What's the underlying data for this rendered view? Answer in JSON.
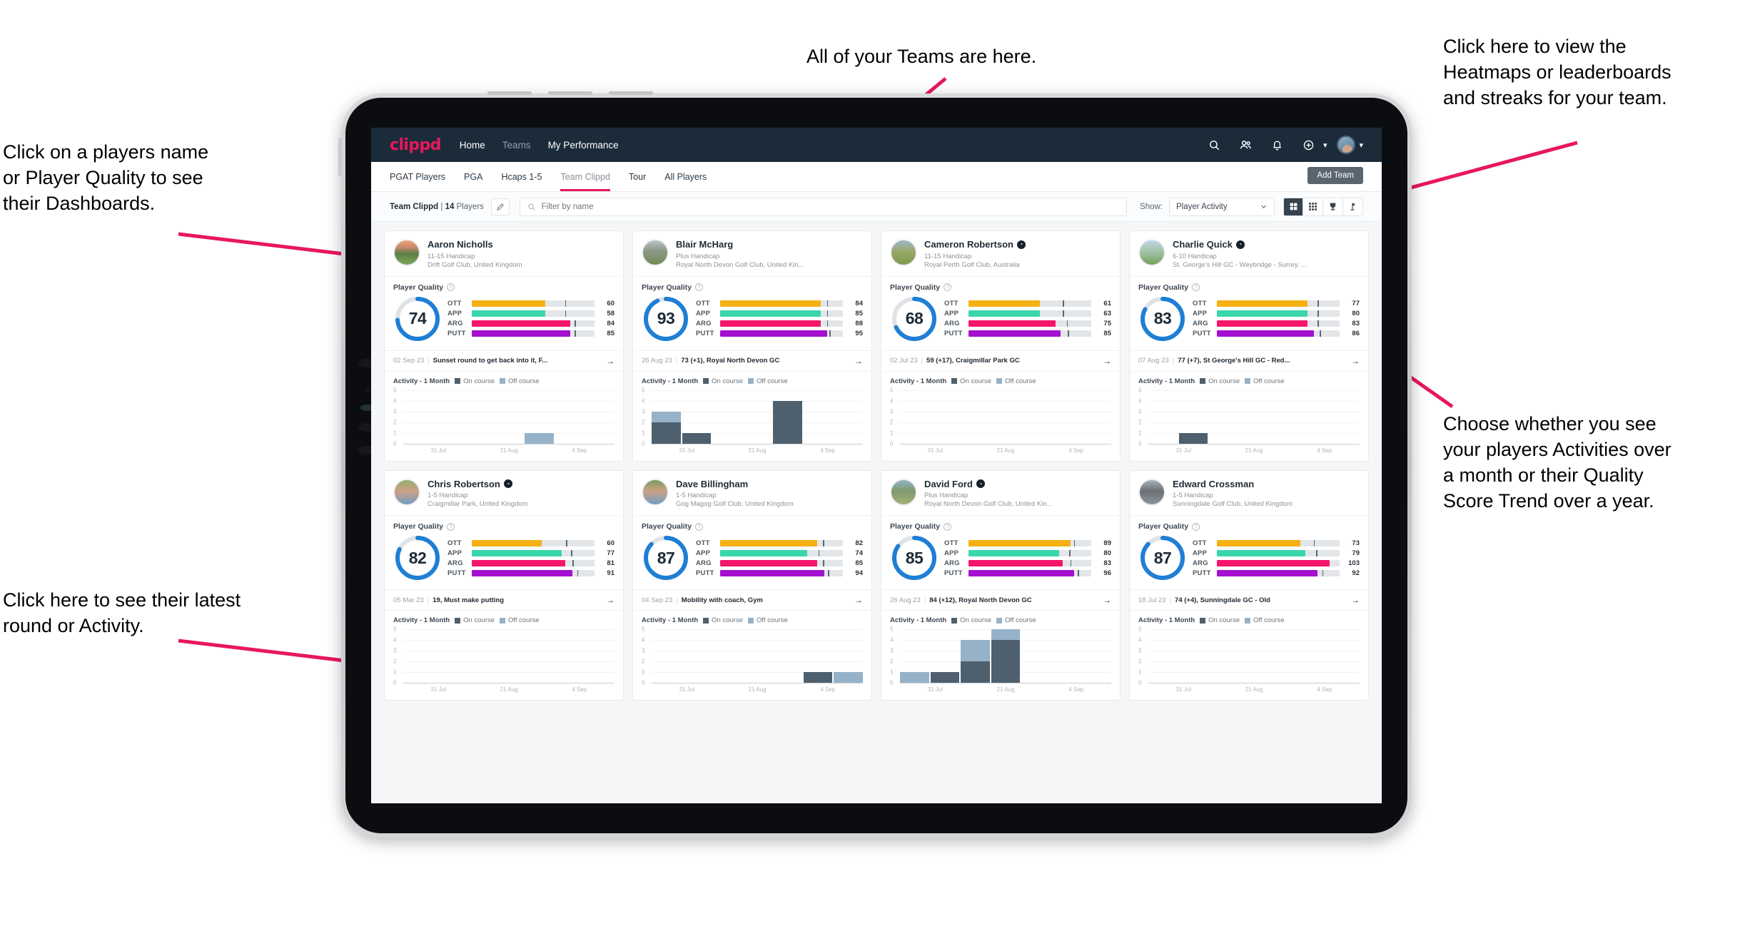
{
  "annotations": [
    {
      "id": "teams",
      "text": "All of your Teams are here."
    },
    {
      "id": "heatmaps",
      "text": "Click here to view the\nHeatmaps or leaderboards\nand streaks for your team."
    },
    {
      "id": "players-name",
      "text": "Click on a players name\nor Player Quality to see\ntheir Dashboards."
    },
    {
      "id": "activity-toggle",
      "text": "Choose whether you see\nyour players Activities over\na month or their Quality\nScore Trend over a year."
    },
    {
      "id": "latest-round",
      "text": "Click here to see their latest\nround or Activity."
    }
  ],
  "app": {
    "logo": "clippd",
    "nav_links": [
      {
        "label": "Home",
        "state": "active"
      },
      {
        "label": "Teams",
        "state": "dim"
      },
      {
        "label": "My Performance",
        "state": "active"
      }
    ],
    "nav_icons": [
      {
        "name": "search-icon"
      },
      {
        "name": "people-icon"
      },
      {
        "name": "bell-icon"
      },
      {
        "name": "plus-circle-icon"
      }
    ],
    "tabs": [
      {
        "label": "PGAT Players",
        "active": false
      },
      {
        "label": "PGA",
        "active": false
      },
      {
        "label": "Hcaps 1-5",
        "active": false
      },
      {
        "label": "Team Clippd",
        "active": true
      },
      {
        "label": "Tour",
        "active": false
      },
      {
        "label": "All Players",
        "active": false
      }
    ],
    "add_team_label": "Add Team",
    "filter": {
      "team_name": "Team Clippd",
      "team_separator": "|",
      "player_count": "14",
      "players_word": "Players",
      "search_placeholder": "Filter by name",
      "search_value": "",
      "show_label": "Show:",
      "show_value": "Player Activity",
      "view_icons": [
        "grid-large-icon",
        "grid-small-icon",
        "trophy-icon",
        "flag-icon"
      ]
    }
  },
  "card_labels": {
    "player_quality": "Player Quality",
    "activity_title": "Activity - 1 Month",
    "legend_on": "On course",
    "legend_off": "Off course",
    "x_ticks": [
      "31 Jul",
      "21 Aug",
      "4 Sep"
    ],
    "y_ticks": [
      "5",
      "4",
      "3",
      "2",
      "1",
      "0"
    ]
  },
  "metric_colors": {
    "OTT": "#f5b014",
    "APP": "#3ad6ab",
    "ARG": "#f5156c",
    "PUTT": "#a50fd0",
    "dial": "#1e7fd4",
    "track": "#dfe3e7"
  },
  "chart_data": {
    "type": "bar",
    "title": "Activity - 1 Month",
    "ylabel": "",
    "xlabel": "",
    "ylim": [
      0,
      5
    ],
    "grid": true,
    "legend_position": "top",
    "categories": [
      "31 Jul",
      "21 Aug",
      "4 Sep"
    ],
    "series_names": [
      "On course",
      "Off course"
    ],
    "per_player": [
      {
        "player": "Aaron Nicholls",
        "on_course": [
          0,
          0,
          0,
          0,
          0,
          0,
          0
        ],
        "off_course": [
          0,
          0,
          0,
          0,
          1,
          0,
          0
        ]
      },
      {
        "player": "Blair McHarg",
        "on_course": [
          2,
          1,
          0,
          0,
          4,
          0,
          0
        ],
        "off_course": [
          1,
          0,
          0,
          0,
          0,
          0,
          0
        ]
      },
      {
        "player": "Cameron Robertson",
        "on_course": [
          0,
          0,
          0,
          0,
          0,
          0,
          0
        ],
        "off_course": [
          0,
          0,
          0,
          0,
          0,
          0,
          0
        ]
      },
      {
        "player": "Charlie Quick",
        "on_course": [
          0,
          1,
          0,
          0,
          0,
          0,
          0
        ],
        "off_course": [
          0,
          0,
          0,
          0,
          0,
          0,
          0
        ]
      },
      {
        "player": "Chris Robertson",
        "on_course": [
          0,
          0,
          0,
          0,
          0,
          0,
          0
        ],
        "off_course": [
          0,
          0,
          0,
          0,
          0,
          0,
          0
        ]
      },
      {
        "player": "Dave Billingham",
        "on_course": [
          0,
          0,
          0,
          0,
          0,
          1,
          0
        ],
        "off_course": [
          0,
          0,
          0,
          0,
          0,
          0,
          1
        ]
      },
      {
        "player": "David Ford",
        "on_course": [
          0,
          1,
          2,
          4,
          0,
          0,
          0
        ],
        "off_course": [
          1,
          0,
          2,
          1,
          0,
          0,
          0
        ]
      },
      {
        "player": "Edward Crossman",
        "on_course": [
          0,
          0,
          0,
          0,
          0,
          0,
          0
        ],
        "off_course": [
          0,
          0,
          0,
          0,
          0,
          0,
          0
        ]
      }
    ]
  },
  "players": [
    {
      "name": "Aaron Nicholls",
      "verified": false,
      "handicap": "11-15 Handicap",
      "club": "Drift Golf Club, United Kingdom",
      "quality": 74,
      "metrics": [
        {
          "label": "OTT",
          "value": 60,
          "fill": 60,
          "tick": 76
        },
        {
          "label": "APP",
          "value": 58,
          "fill": 60,
          "tick": 76
        },
        {
          "label": "ARG",
          "value": 84,
          "fill": 80,
          "tick": 84
        },
        {
          "label": "PUTT",
          "value": 85,
          "fill": 80,
          "tick": 84
        }
      ],
      "latest_date": "02 Sep 23",
      "latest_text": "Sunset round to get back into it, F...",
      "avatar": "course-sunset"
    },
    {
      "name": "Blair McHarg",
      "verified": false,
      "handicap": "Plus Handicap",
      "club": "Royal North Devon Golf Club, United Kin...",
      "quality": 93,
      "metrics": [
        {
          "label": "OTT",
          "value": 84,
          "fill": 82,
          "tick": 87
        },
        {
          "label": "APP",
          "value": 85,
          "fill": 82,
          "tick": 87
        },
        {
          "label": "ARG",
          "value": 88,
          "fill": 82,
          "tick": 87
        },
        {
          "label": "PUTT",
          "value": 95,
          "fill": 87,
          "tick": 89
        }
      ],
      "latest_date": "26 Aug 23",
      "latest_text": "73 (+1), Royal North Devon GC",
      "avatar": "golfer-green"
    },
    {
      "name": "Cameron Robertson",
      "verified": true,
      "handicap": "11-15 Handicap",
      "club": "Royal Perth Golf Club, Australia",
      "quality": 68,
      "metrics": [
        {
          "label": "OTT",
          "value": 61,
          "fill": 58,
          "tick": 77
        },
        {
          "label": "APP",
          "value": 63,
          "fill": 58,
          "tick": 77
        },
        {
          "label": "ARG",
          "value": 75,
          "fill": 71,
          "tick": 80
        },
        {
          "label": "PUTT",
          "value": 85,
          "fill": 75,
          "tick": 81
        }
      ],
      "latest_date": "02 Jul 23",
      "latest_text": "59 (+17), Craigmillar Park GC",
      "avatar": "fairway"
    },
    {
      "name": "Charlie Quick",
      "verified": true,
      "handicap": "6-10 Handicap",
      "club": "St. George's Hill GC - Weybridge - Surrey, ...",
      "quality": 83,
      "metrics": [
        {
          "label": "OTT",
          "value": 77,
          "fill": 74,
          "tick": 82
        },
        {
          "label": "APP",
          "value": 80,
          "fill": 74,
          "tick": 82
        },
        {
          "label": "ARG",
          "value": 83,
          "fill": 74,
          "tick": 82
        },
        {
          "label": "PUTT",
          "value": 86,
          "fill": 79,
          "tick": 84
        }
      ],
      "latest_date": "07 Aug 23",
      "latest_text": "77 (+7), St George's Hill GC - Red...",
      "avatar": "sky-green"
    },
    {
      "name": "Chris Robertson",
      "verified": true,
      "handicap": "1-5 Handicap",
      "club": "Craigmillar Park, United Kingdom",
      "quality": 82,
      "metrics": [
        {
          "label": "OTT",
          "value": 60,
          "fill": 57,
          "tick": 77
        },
        {
          "label": "APP",
          "value": 77,
          "fill": 73,
          "tick": 81
        },
        {
          "label": "ARG",
          "value": 81,
          "fill": 76,
          "tick": 82
        },
        {
          "label": "PUTT",
          "value": 91,
          "fill": 82,
          "tick": 86
        }
      ],
      "latest_date": "05 Mar 23",
      "latest_text": "19, Must make putting",
      "avatar": "man-blue-shirt"
    },
    {
      "name": "Dave Billingham",
      "verified": false,
      "handicap": "1-5 Handicap",
      "club": "Gog Magog Golf Club, United Kingdom",
      "quality": 87,
      "metrics": [
        {
          "label": "OTT",
          "value": 82,
          "fill": 79,
          "tick": 84
        },
        {
          "label": "APP",
          "value": 74,
          "fill": 71,
          "tick": 80
        },
        {
          "label": "ARG",
          "value": 85,
          "fill": 79,
          "tick": 84
        },
        {
          "label": "PUTT",
          "value": 94,
          "fill": 85,
          "tick": 88
        }
      ],
      "latest_date": "04 Sep 23",
      "latest_text": "Mobility with coach, Gym",
      "avatar": "man-beard"
    },
    {
      "name": "David Ford",
      "verified": true,
      "handicap": "Plus Handicap",
      "club": "Royal North Devon Golf Club, United Kin...",
      "quality": 85,
      "metrics": [
        {
          "label": "OTT",
          "value": 89,
          "fill": 83,
          "tick": 86
        },
        {
          "label": "APP",
          "value": 80,
          "fill": 74,
          "tick": 82
        },
        {
          "label": "ARG",
          "value": 83,
          "fill": 77,
          "tick": 83
        },
        {
          "label": "PUTT",
          "value": 96,
          "fill": 86,
          "tick": 89
        }
      ],
      "latest_date": "26 Aug 23",
      "latest_text": "84 (+12), Royal North Devon GC",
      "avatar": "golfer-hill"
    },
    {
      "name": "Edward Crossman",
      "verified": false,
      "handicap": "1-5 Handicap",
      "club": "Sunningdale Golf Club, United Kingdom",
      "quality": 87,
      "metrics": [
        {
          "label": "OTT",
          "value": 73,
          "fill": 68,
          "tick": 79
        },
        {
          "label": "APP",
          "value": 79,
          "fill": 72,
          "tick": 81
        },
        {
          "label": "ARG",
          "value": 103,
          "fill": 92,
          "tick": 0
        },
        {
          "label": "PUTT",
          "value": 92,
          "fill": 82,
          "tick": 86
        }
      ],
      "latest_date": "18 Jul 23",
      "latest_text": "74 (+4), Sunningdale GC - Old",
      "avatar": "person-car"
    }
  ]
}
